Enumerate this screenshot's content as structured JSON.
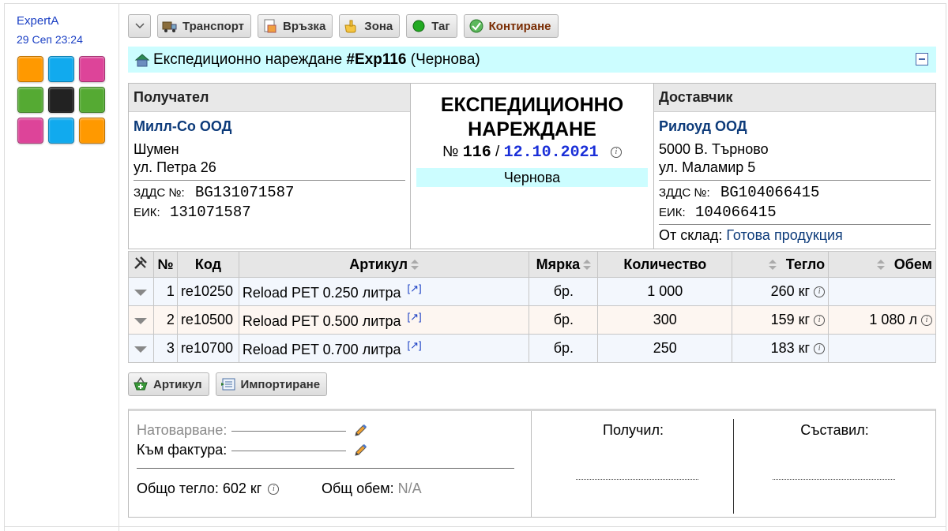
{
  "sidebar": {
    "author": "ExpertA",
    "date": "29 Сеп 23:24",
    "tile_colors": [
      "#ff9900",
      "#11aaee",
      "#dd4499",
      "#55aa33",
      "#222222",
      "#55aa33",
      "#dd4499",
      "#11aaee",
      "#ff9900"
    ]
  },
  "toolbar": {
    "transport": "Транспорт",
    "link": "Връзка",
    "zone": "Зона",
    "tag": "Таг",
    "contiring": "Контиране"
  },
  "document": {
    "title_prefix": "Експедиционно нареждане",
    "number_ref": "#Exp116",
    "state": "(Чернова)"
  },
  "recipient": {
    "heading": "Получател",
    "name": "Милл-Со ООД",
    "city": "Шумен",
    "address": "ул. Петра 26",
    "vat_label": "ЗДДС №:",
    "vat": "BG131071587",
    "eik_label": "ЕИК:",
    "eik": "131071587"
  },
  "center": {
    "title_line1": "ЕКСПЕДИЦИОННО",
    "title_line2": "НАРЕЖДАНЕ",
    "number_label": "№",
    "number": "116",
    "slash": "/",
    "date": "12.10.2021",
    "status": "Чернова"
  },
  "supplier": {
    "heading": "Доставчик",
    "name": "Рилоуд ООД",
    "city": "5000 В. Търново",
    "address": "ул. Маламир 5",
    "vat_label": "ЗДДС №:",
    "vat": "BG104066415",
    "eik_label": "ЕИК:",
    "eik": "104066415",
    "store_label": "От склад:",
    "store": "Готова продукция"
  },
  "table": {
    "headers": {
      "num": "№",
      "code": "Код",
      "article": "Артикул",
      "measure": "Мярка",
      "quantity": "Количество",
      "weight": "Тегло",
      "volume": "Обем"
    },
    "rows": [
      {
        "num": "1",
        "code": "re10250",
        "article": "Reload PET 0.250 литра",
        "ext": "[↗]",
        "measure": "бр.",
        "quantity": "1 000",
        "weight": "260 кг",
        "volume": ""
      },
      {
        "num": "2",
        "code": "re10500",
        "article": "Reload PET 0.500 литра",
        "ext": "[↗]",
        "measure": "бр.",
        "quantity": "300",
        "weight": "159 кг",
        "volume": "1 080 л"
      },
      {
        "num": "3",
        "code": "re10700",
        "article": "Reload PET 0.700 литра",
        "ext": "[↗]",
        "measure": "бр.",
        "quantity": "250",
        "weight": "183 кг",
        "volume": ""
      }
    ]
  },
  "actions": {
    "article": "Артикул",
    "import": "Импортиране"
  },
  "footer": {
    "loading_label": "Натоварване:",
    "invoice_label": "Към фактура:",
    "total_weight_label": "Общо тегло:",
    "total_weight": "602 кг",
    "total_volume_label": "Общ обем:",
    "total_volume": "N/A",
    "received_label": "Получил:",
    "compiled_label": "Съставил:"
  }
}
